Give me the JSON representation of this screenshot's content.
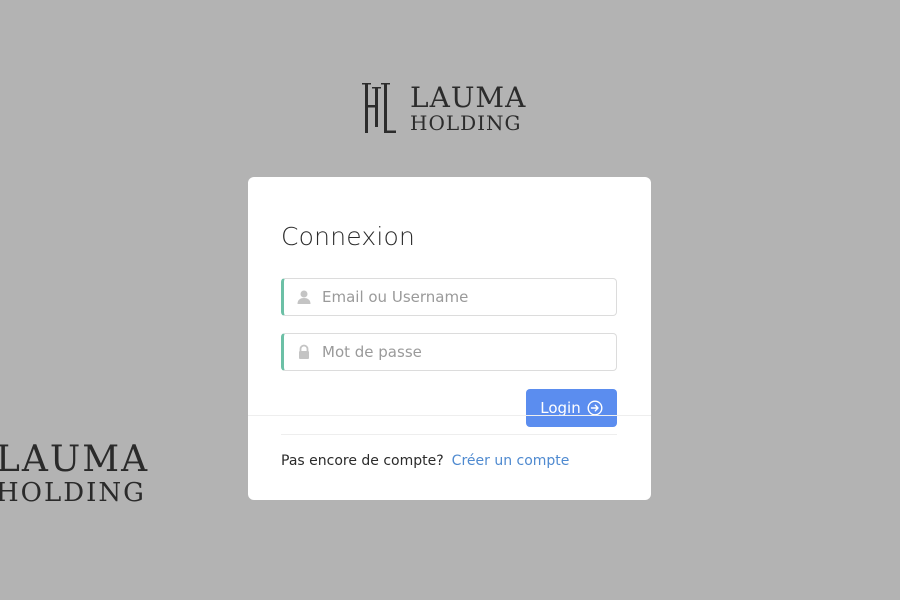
{
  "logo": {
    "line1": "LAUMA",
    "line2": "HOLDING",
    "mark_icon": "hl-monogram-icon"
  },
  "watermark": {
    "line1": "LAUMA",
    "line2": "HOLDING"
  },
  "login": {
    "title": "Connexion",
    "email": {
      "placeholder": "Email ou Username",
      "value": "",
      "icon": "user-icon"
    },
    "password": {
      "placeholder": "Mot de passe",
      "value": "",
      "icon": "lock-icon"
    },
    "button_label": "Login",
    "button_icon": "arrow-right-circle-icon"
  },
  "footer": {
    "prompt": "Pas encore de compte?",
    "link_label": "Créer un compte"
  },
  "colors": {
    "background": "#b3b3b3",
    "card": "#ffffff",
    "accent_border": "#6cc0a6",
    "button": "#5b8def",
    "link": "#4f8ad0"
  }
}
